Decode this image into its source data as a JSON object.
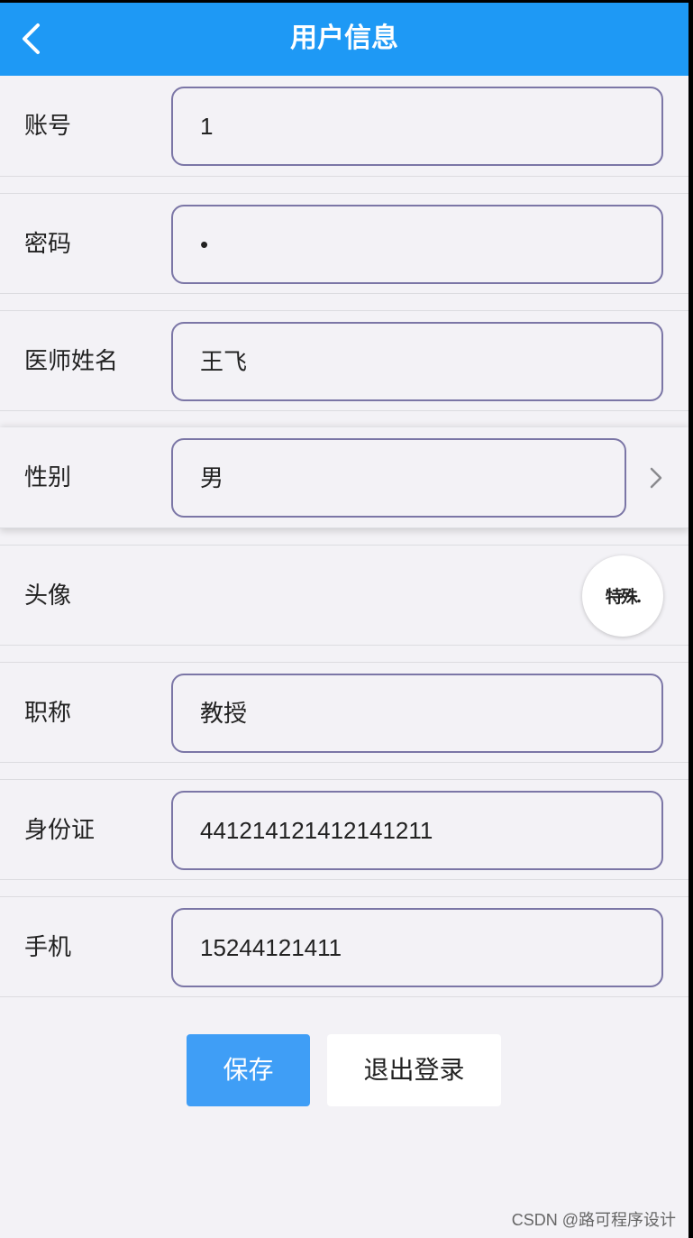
{
  "header": {
    "title": "用户信息"
  },
  "form": {
    "account": {
      "label": "账号",
      "value": "1"
    },
    "password": {
      "label": "密码",
      "value": "•"
    },
    "doctor_name": {
      "label": "医师姓名",
      "value": "王飞"
    },
    "gender": {
      "label": "性别",
      "value": "男"
    },
    "avatar": {
      "label": "头像",
      "image_text": "特殊."
    },
    "title": {
      "label": "职称",
      "value": "教授"
    },
    "id_card": {
      "label": "身份证",
      "value": "441214121412141211"
    },
    "phone": {
      "label": "手机",
      "value": "15244121411"
    }
  },
  "actions": {
    "save_label": "保存",
    "logout_label": "退出登录"
  },
  "watermark": "CSDN @路可程序设计",
  "colors": {
    "header_bg": "#1e99f5",
    "primary_button": "#3f9ef6",
    "field_border": "#7b76a6",
    "page_bg": "#f3f2f6"
  }
}
